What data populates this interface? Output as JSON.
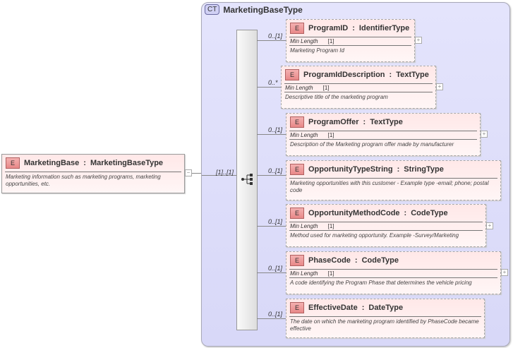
{
  "root": {
    "badge": "E",
    "name": "MarketingBase",
    "type": "MarketingBaseType",
    "documentation": "Marketing information such as marketing programs, marketing opportunities, etc.",
    "cardinality": "[1]..[1]",
    "toggle": "−"
  },
  "complex_type": {
    "badge": "CT",
    "name": "MarketingBaseType"
  },
  "sequence_icon": "sequence-icon",
  "children": [
    {
      "badge": "E",
      "name": "ProgramID",
      "type": "IdentifierType",
      "cardinality": "0..[1]",
      "facet_label": "Min Length",
      "facet_value": "[1]",
      "documentation": "Marketing Program Id",
      "expand": "+"
    },
    {
      "badge": "E",
      "name": "ProgramIdDescription",
      "type": "TextType",
      "cardinality": "0..*",
      "facet_label": "Min Length",
      "facet_value": "[1]",
      "documentation": "Descriptive title of the marketing program",
      "expand": "+"
    },
    {
      "badge": "E",
      "name": "ProgramOffer",
      "type": "TextType",
      "cardinality": "0..[1]",
      "facet_label": "Min Length",
      "facet_value": "[1]",
      "documentation": "Description of the Marketing program offer made by manufacturer",
      "expand": "+"
    },
    {
      "badge": "E",
      "name": "OpportunityTypeString",
      "type": "StringType",
      "cardinality": "0..[1]",
      "documentation": "Marketing opportunities with this customer - Example type -email; phone; postal code"
    },
    {
      "badge": "E",
      "name": "OpportunityMethodCode",
      "type": "CodeType",
      "cardinality": "0..[1]",
      "facet_label": "Min Length",
      "facet_value": "[1]",
      "documentation": "Method used for marketing opportunity. Example -Survey/Marketing",
      "expand": "+"
    },
    {
      "badge": "E",
      "name": "PhaseCode",
      "type": "CodeType",
      "cardinality": "0..[1]",
      "facet_label": "Min Length",
      "facet_value": "[1]",
      "documentation": "A code identifying the Program Phase that determines the vehicle pricing",
      "expand": "+"
    },
    {
      "badge": "E",
      "name": "EffectiveDate",
      "type": "DateType",
      "cardinality": "0..[1]",
      "documentation": "The date on which the marketing program identified by PhaseCode became effective"
    }
  ]
}
